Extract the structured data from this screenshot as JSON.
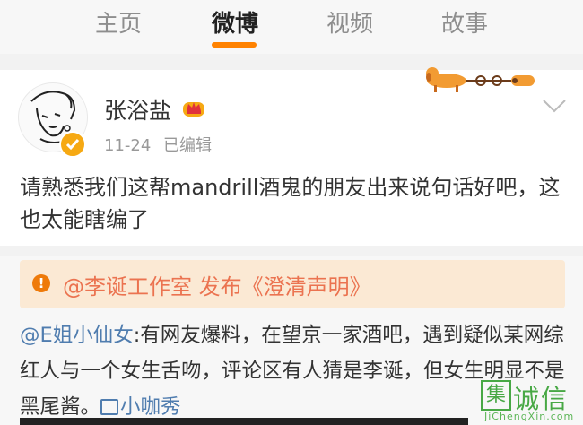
{
  "tabs": [
    {
      "label": "主页",
      "active": false
    },
    {
      "label": "微博",
      "active": true
    },
    {
      "label": "视频",
      "active": false
    },
    {
      "label": "故事",
      "active": false
    }
  ],
  "post": {
    "author": "张浴盐",
    "time": "11-24",
    "edited": "已编辑",
    "text": "请熟悉我们这帮mandrill酒鬼的朋友出来说句话好吧，这也太能瞎编了"
  },
  "repost": {
    "notice": "@李诞工作室 发布《澄清声明》",
    "mention": "@E姐小仙女",
    "text": ":有网友爆料，在望京一家酒吧，遇到疑似某网综红人与一个女生舌吻，评论区有人猜是李诞，但女生明显不是黑尾酱。",
    "link_label": "小咖秀"
  },
  "watermark": {
    "box_char": "集",
    "text": "诚信",
    "url": "JiChengXin.com"
  },
  "colors": {
    "accent": "#ff8200",
    "link": "#507daf",
    "notice_bg": "#fbe9d4",
    "notice_text": "#eb7350",
    "watermark": "#48a845"
  }
}
